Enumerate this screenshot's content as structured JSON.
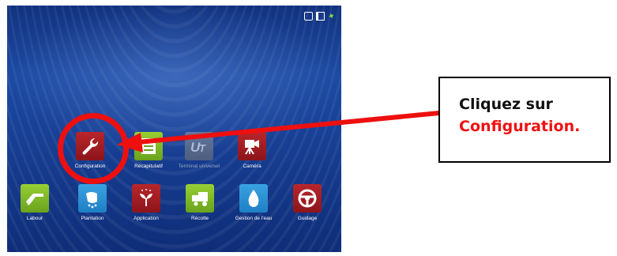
{
  "colors": {
    "annotation": "#ee0f0f",
    "tile_red": "#b8262b",
    "tile_green": "#7fbf28",
    "tile_blue": "#2b90d6",
    "screen_bg": "#1a4499"
  },
  "status_icons": [
    "usb-icon",
    "sd-card-icon",
    "gps-satellite-icon"
  ],
  "apps_row1": [
    {
      "label": "Configuration",
      "icon": "wrench-icon",
      "color": "red"
    },
    {
      "label": "Récapitulatif",
      "icon": "list-summary-icon",
      "color": "green"
    },
    {
      "label": "Terminal universel",
      "icon": "ut-icon",
      "color": "gray",
      "disabled": true
    },
    {
      "label": "Caméra",
      "icon": "camera-icon",
      "color": "red"
    }
  ],
  "apps_row2": [
    {
      "label": "Labour",
      "icon": "plow-icon",
      "color": "green"
    },
    {
      "label": "Plantation",
      "icon": "planting-hand-icon",
      "color": "blue"
    },
    {
      "label": "Application",
      "icon": "sprout-spray-icon",
      "color": "red"
    },
    {
      "label": "Récolte",
      "icon": "combine-icon",
      "color": "green"
    },
    {
      "label": "Gestion de l'eau",
      "icon": "water-drop-icon",
      "color": "blue"
    },
    {
      "label": "Guidage",
      "icon": "steering-wheel-icon",
      "color": "red"
    }
  ],
  "callout": {
    "line1": "Cliquez sur",
    "line2": "Configuration."
  }
}
